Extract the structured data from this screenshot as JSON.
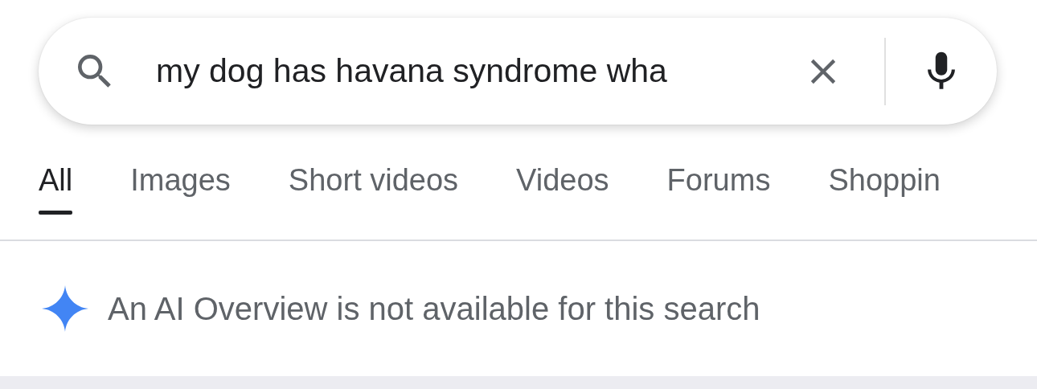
{
  "search": {
    "value": "my dog has havana syndrome wha"
  },
  "tabs": [
    {
      "label": "All",
      "selected": true
    },
    {
      "label": "Images",
      "selected": false
    },
    {
      "label": "Short videos",
      "selected": false
    },
    {
      "label": "Videos",
      "selected": false
    },
    {
      "label": "Forums",
      "selected": false
    },
    {
      "label": "Shoppin",
      "selected": false
    }
  ],
  "ai_notice": {
    "text": "An AI Overview is not available for this search"
  }
}
